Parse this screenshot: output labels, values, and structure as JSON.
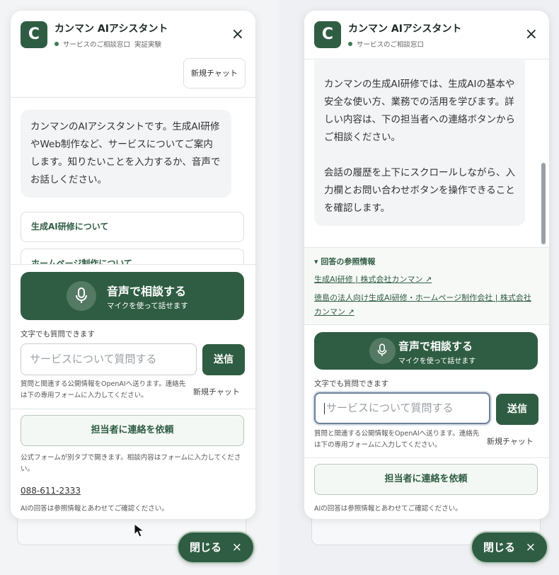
{
  "app": {
    "title": "カンマン AIアシスタント",
    "avatar_letter": "C",
    "close_icon": "×"
  },
  "left": {
    "status": "サービスのご相談窓口",
    "status_extra": "実証実験",
    "new_chat_top": "新規チャット",
    "message": "カンマンのAIアシスタントです。生成AI研修やWeb制作など、サービスについてご案内します。知りたいことを入力するか、音声でお話しください。",
    "topics": [
      "生成AI研修について",
      "ホームページ制作について"
    ],
    "voice_main": "音声で相談する",
    "voice_sub": "マイクを使って話せます",
    "text_label": "文字でも質問できます",
    "input_placeholder": "サービスについて質問する",
    "send_label": "送信",
    "privacy_note": "質問と関連する公開情報をOpenAIへ送ります。連絡先は下の専用フォームに入力してください。",
    "new_chat_link": "新規チャット",
    "contact_button": "担当者に連絡を依頼",
    "form_note": "公式フォームが別タブで開きます。相談内容はフォームに入力してください。",
    "phone": "088-611-2333",
    "footer_note": "AIの回答は参照情報とあわせてご確認ください。",
    "close_pill": "閉じる"
  },
  "right": {
    "status": "サービスのご相談窓口",
    "message_p1": "カンマンの生成AI研修では、生成AIの基本や安全な使い方、業務での活用を学びます。詳しい内容は、下の担当者への連絡ボタンからご相談ください。",
    "message_p2": "会話の履歴を上下にスクロールしながら、入力欄とお問い合わせボタンを操作できることを確認します。",
    "ref_title": "▾ 回答の参照情報",
    "ref_links": [
      "生成AI研修 | 株式会社カンマン ↗",
      "徳島の法人向け生成AI研修・ホームページ制作会社 | 株式会社カンマン ↗"
    ],
    "voice_main": "音声で相談する",
    "voice_sub": "マイクを使って話せます",
    "text_label": "文字でも質問できます",
    "input_placeholder": "サービスについて質問する",
    "send_label": "送信",
    "privacy_note": "質問と関連する公開情報をOpenAIへ送ります。連絡先は下の専用フォームに入力してください。",
    "new_chat_link": "新規チャット",
    "contact_button": "担当者に連絡を依頼",
    "footer_note": "AIの回答は参照情報とあわせてご確認ください。",
    "close_pill": "閉じる"
  },
  "colors": {
    "brand_green": "#2f5d43",
    "bubble_bg": "#f2f4f6"
  }
}
